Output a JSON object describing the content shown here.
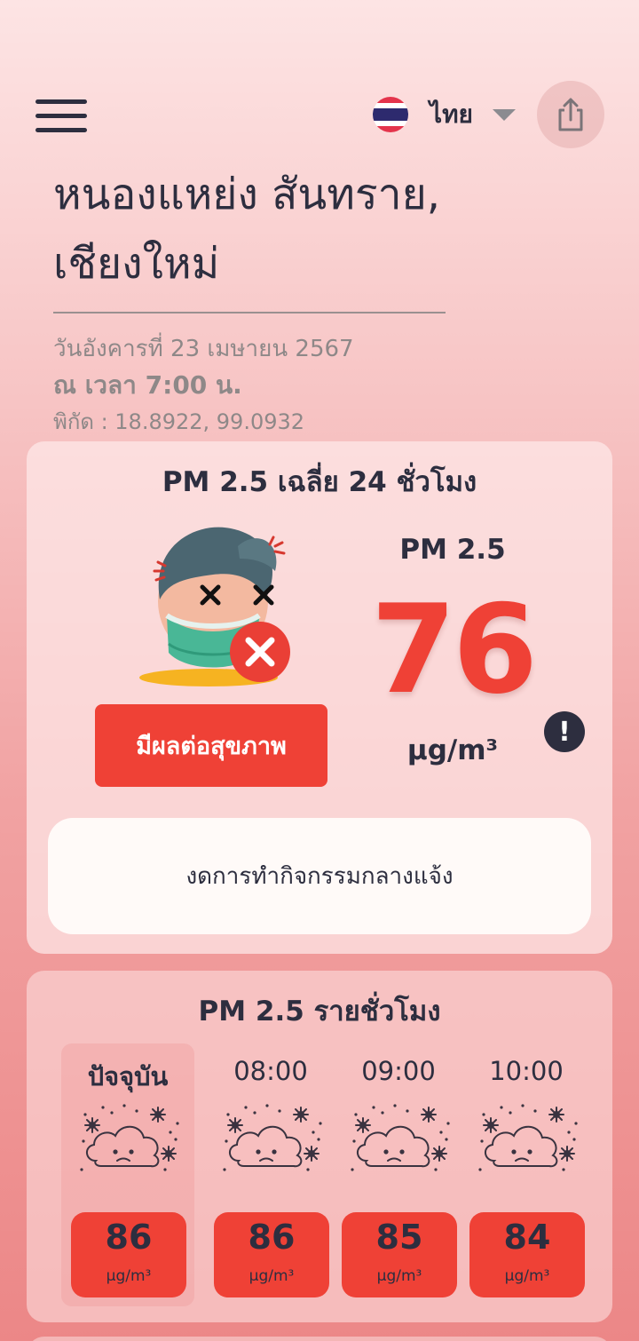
{
  "header": {
    "language": "ไทย",
    "icons": {
      "menu": "hamburger-menu-icon",
      "share": "share-icon",
      "flag": "thailand-flag-icon",
      "caret": "chevron-down-icon"
    },
    "flag_colors": [
      "#e4344c",
      "#ffffff",
      "#2d2a6e",
      "#ffffff",
      "#e4344c"
    ]
  },
  "location": {
    "title": "หนองแหย่ง สันทราย, เชียงใหม่",
    "date": "วันอังคารที่ 23 เมษายน 2567",
    "time": "ณ เวลา 7:00 น.",
    "coords": "พิกัด : 18.8922, 99.0932"
  },
  "daily": {
    "title": "PM 2.5 เฉลี่ย 24 ชั่วโมง",
    "status": "มีผลต่อสุขภาพ",
    "pm_label": "PM 2.5",
    "pm_value": "76",
    "unit": "μg/m³",
    "info_symbol": "!",
    "advice": "งดการทำกิจกรรมกลางแจ้ง",
    "status_color": "#ef4136"
  },
  "hourly": {
    "title": "PM 2.5 รายชั่วโมง",
    "items": [
      {
        "time": "ปัจจุบัน",
        "value": "86",
        "unit": "μg/m³",
        "icon": "hazy-cloud-icon"
      },
      {
        "time": "08:00",
        "value": "86",
        "unit": "μg/m³",
        "icon": "hazy-cloud-icon"
      },
      {
        "time": "09:00",
        "value": "85",
        "unit": "μg/m³",
        "icon": "hazy-cloud-icon"
      },
      {
        "time": "10:00",
        "value": "84",
        "unit": "μg/m³",
        "icon": "hazy-cloud-icon"
      }
    ]
  }
}
